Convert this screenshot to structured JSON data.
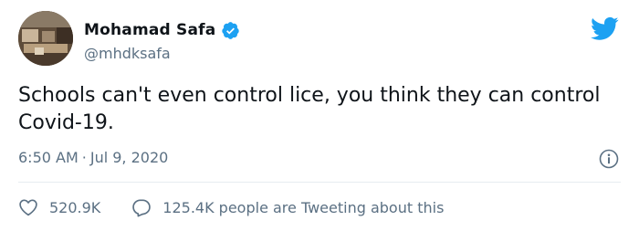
{
  "author": {
    "display_name": "Mohamad Safa",
    "handle": "@mhdksafa",
    "verified": true
  },
  "tweet": {
    "text": "Schools can't even control lice, you think they can control Covid-19.",
    "time": "6:50 AM",
    "separator": "·",
    "date": "Jul 9, 2020"
  },
  "stats": {
    "likes": "520.9K",
    "tweeting": "125.4K people are Tweeting about this"
  },
  "colors": {
    "brand": "#1da1f2",
    "secondary_text": "#5b7083",
    "divider": "#e6ecf0"
  },
  "icons": {
    "brand": "twitter-bird-icon",
    "verified": "verified-badge-icon",
    "info": "info-icon",
    "like": "heart-icon",
    "reply": "speech-bubble-icon"
  }
}
